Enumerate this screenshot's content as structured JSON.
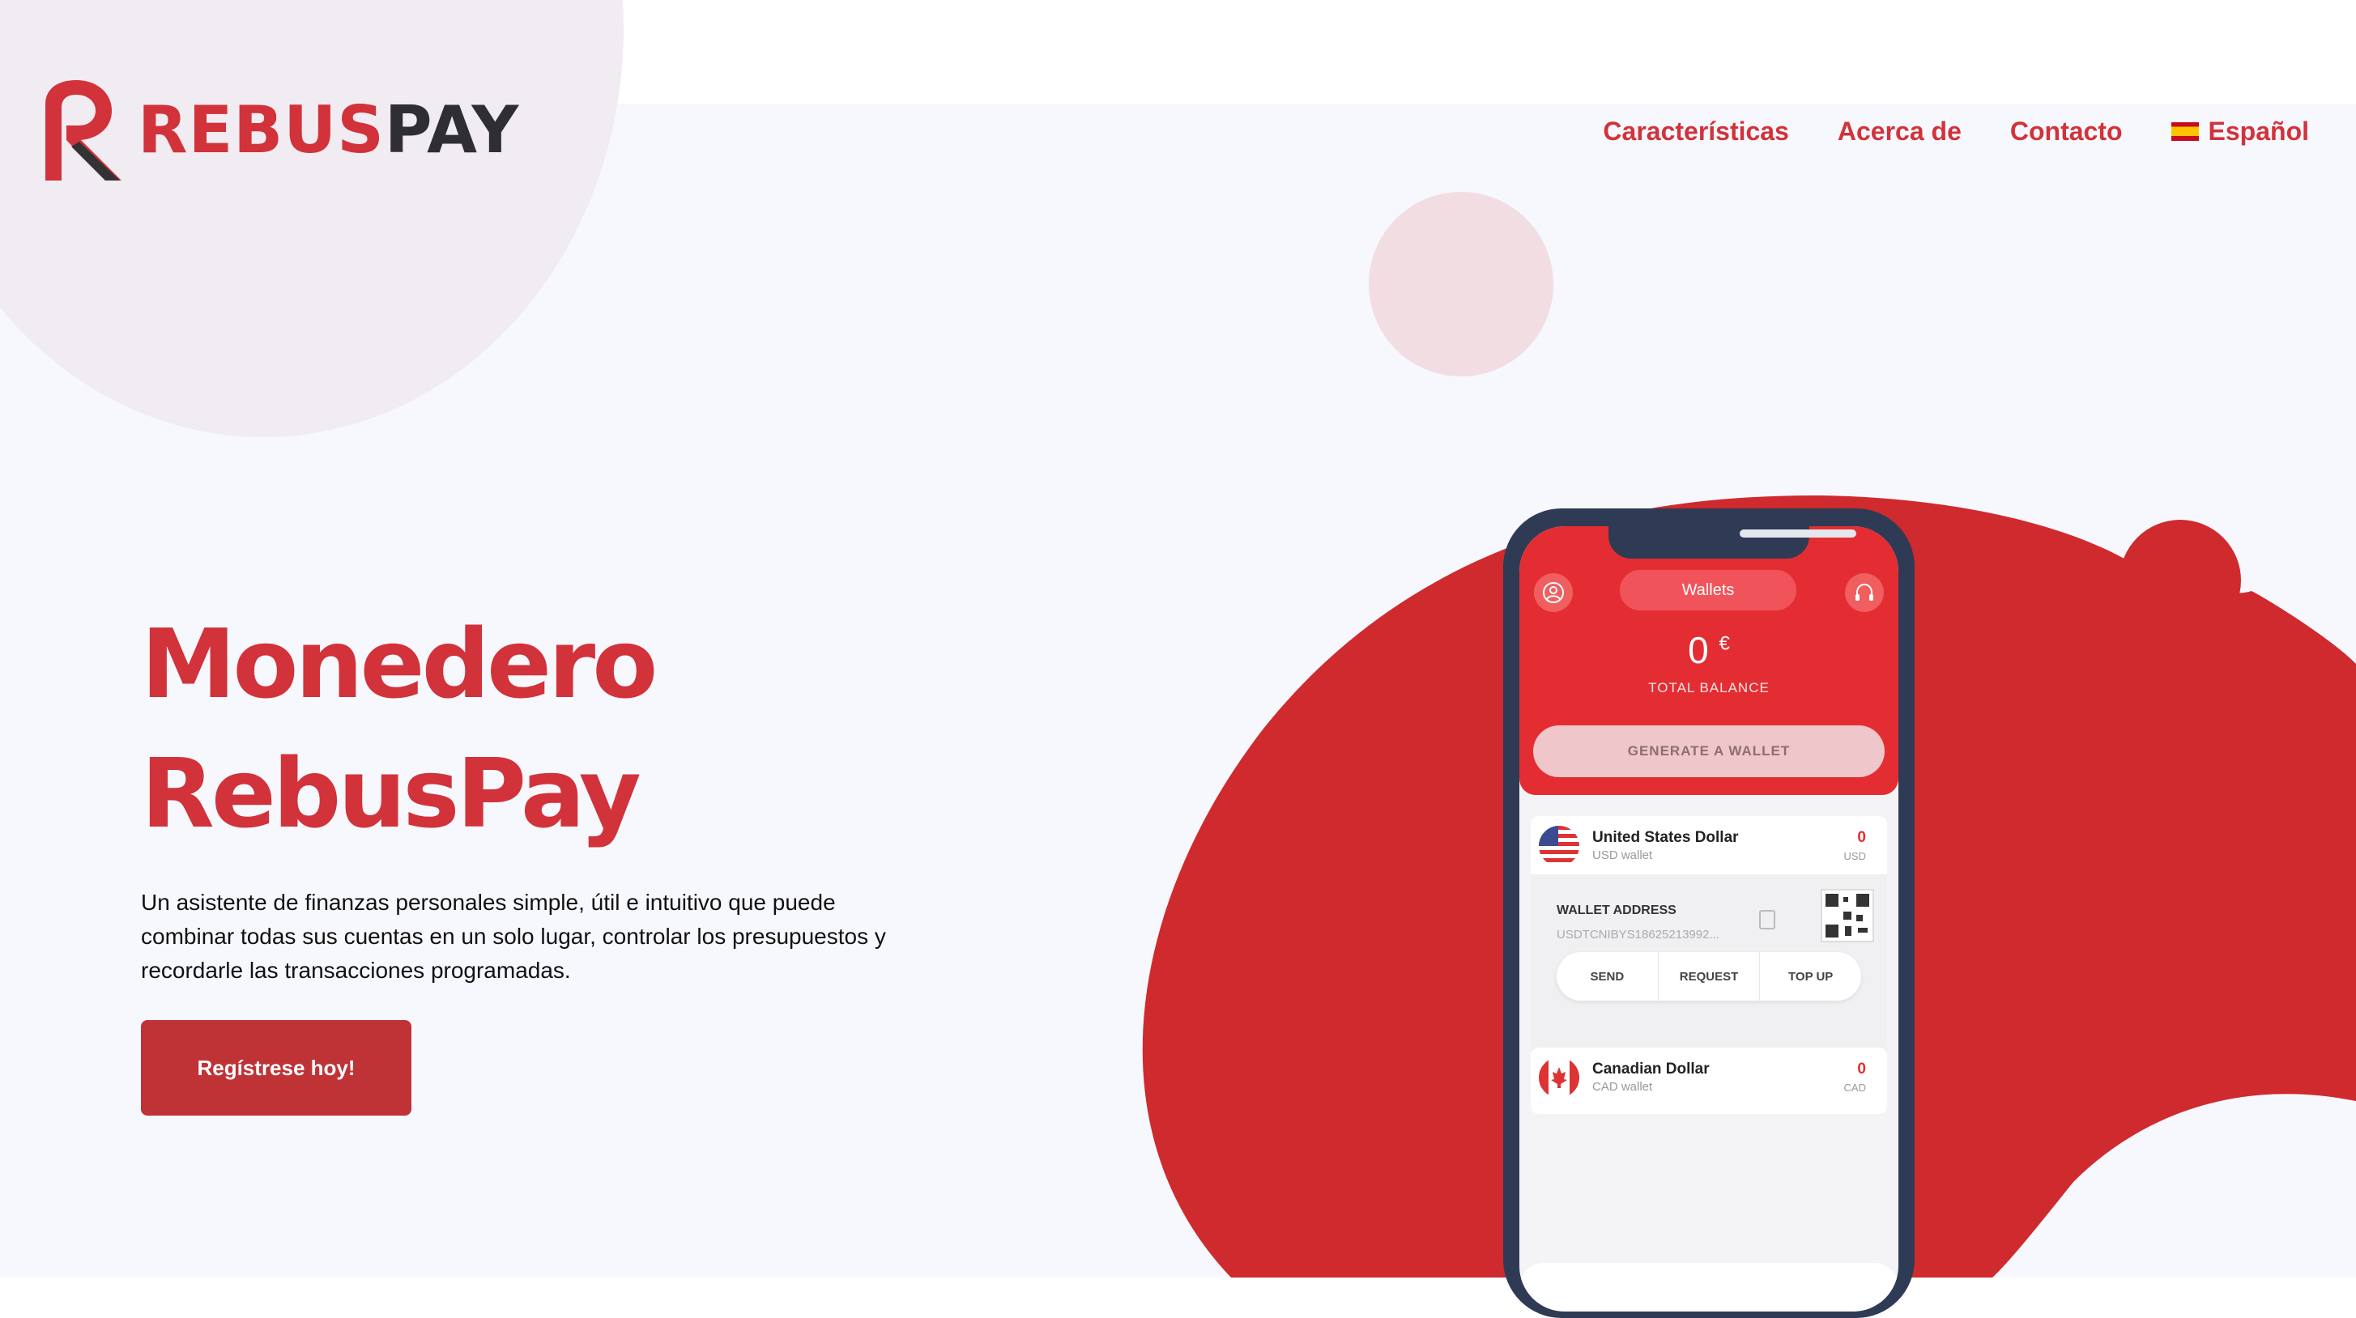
{
  "logo": {
    "part1": "REBUS",
    "part2": "PAY"
  },
  "nav": {
    "items": [
      "Características",
      "Acerca de",
      "Contacto"
    ],
    "language": "Español"
  },
  "hero": {
    "title_line1": "Monedero",
    "title_line2": "RebusPay",
    "description": "Un asistente de finanzas personales simple, útil e intuitivo que puede combinar todas sus cuentas en un solo lugar, controlar los presupuestos y recordarle las transacciones programadas.",
    "cta": "Regístrese hoy!"
  },
  "phone": {
    "header_tab": "Wallets",
    "balance": "0",
    "currency_symbol": "€",
    "balance_label": "TOTAL BALANCE",
    "generate_button": "GENERATE A WALLET",
    "wallets": [
      {
        "name": "United States Dollar",
        "subtitle": "USD wallet",
        "amount": "0",
        "code": "USD"
      },
      {
        "name": "Canadian Dollar",
        "subtitle": "CAD wallet",
        "amount": "0",
        "code": "CAD"
      }
    ],
    "wallet_address_label": "WALLET ADDRESS",
    "wallet_address_value": "USDTCNIBYS18625213992...",
    "actions": [
      "SEND",
      "REQUEST",
      "TOP UP"
    ]
  },
  "colors": {
    "brand_red": "#d2323a",
    "dark": "#2f2f33",
    "background": "#f7f8fd"
  },
  "icons": [
    "user-icon",
    "headset-icon",
    "copy-icon",
    "qr-code-icon"
  ]
}
